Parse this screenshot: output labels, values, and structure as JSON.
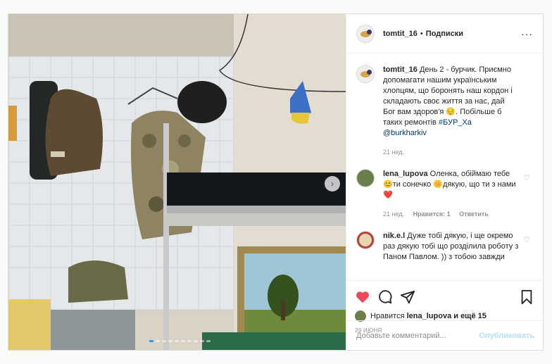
{
  "post": {
    "username": "tomtit_16",
    "follow_label": "Подписки",
    "separator": "•",
    "more_glyph": "···",
    "caption": {
      "text": "День 2 - бурчик. Приємно допомагати нашим українським хлопцям, що боронять наш кордон і складають своє життя за нас, дай Бог вам здоров'я 😔. Побільше б таких ремонтів ",
      "hashtag": "#БУР_Ха",
      "mention": "@burkharkiv",
      "time": "21 нед."
    },
    "comments": [
      {
        "username": "lena_lupova",
        "text": "Оленка, обіймаю тебе😊ти сонечко 🌼дякую, що ти з нами❤️",
        "time": "21 нед.",
        "likes": "Нравится: 1",
        "reply": "Ответить"
      },
      {
        "username": "nik.e.l",
        "text": "Дуже тобі дякую, і ще окремо раз дякую тобі що розділила роботу з Паном Павлом. )) з тобою завжди"
      }
    ],
    "likes": {
      "prefix": "Нравится",
      "user": "lena_lupova",
      "suffix": "и ещё 15"
    },
    "date": "29 ИЮНЯ",
    "comment_input": {
      "placeholder": "Добавьте комментарий..."
    },
    "publish_label": "Опубликовать",
    "carousel_next": "›"
  },
  "colors": {
    "heart": "#ed4956",
    "link": "#00376b",
    "publish_disabled": "#b2dffc",
    "carousel_active": "#3897f0"
  },
  "icons": [
    "heart-icon",
    "comment-icon",
    "share-icon",
    "bookmark-icon",
    "more-icon",
    "chevron-right-icon"
  ]
}
